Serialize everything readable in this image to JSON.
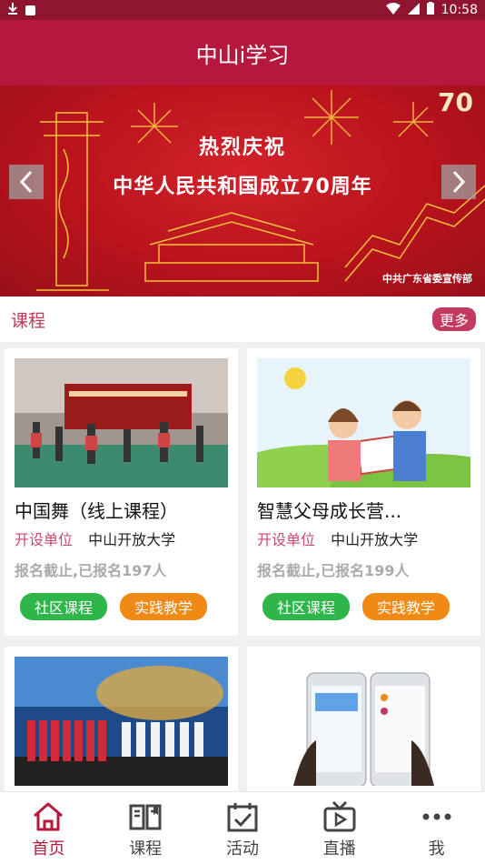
{
  "status": {
    "time": "10:58"
  },
  "app": {
    "title": "中山i学习"
  },
  "banner": {
    "title": "热烈庆祝",
    "subtitle": "中华人民共和国成立70周年",
    "credit": "中共广东省委宣传部"
  },
  "section": {
    "title": "课程",
    "more_label": "更多"
  },
  "courses": [
    {
      "title": "中国舞（线上课程）",
      "org_label": "开设单位",
      "org": "中山开放大学",
      "enroll": "报名截止,已报名197人",
      "tags": [
        "社区课程",
        "实践教学"
      ]
    },
    {
      "title": "智慧父母成长营...",
      "org_label": "开设单位",
      "org": "中山开放大学",
      "enroll": "报名截止,已报名199人",
      "tags": [
        "社区课程",
        "实践教学"
      ]
    }
  ],
  "tabs": [
    {
      "label": "首页",
      "icon": "home-icon",
      "active": true
    },
    {
      "label": "课程",
      "icon": "book-icon",
      "active": false
    },
    {
      "label": "活动",
      "icon": "calendar-check-icon",
      "active": false
    },
    {
      "label": "直播",
      "icon": "tv-play-icon",
      "active": false
    },
    {
      "label": "我",
      "icon": "more-dots-icon",
      "active": false
    }
  ],
  "colors": {
    "primary": "#b5173d",
    "status_bar": "#8e1430",
    "accent_pink": "#c23a60",
    "tag_green": "#2eb64a",
    "tag_orange": "#f08a14"
  }
}
